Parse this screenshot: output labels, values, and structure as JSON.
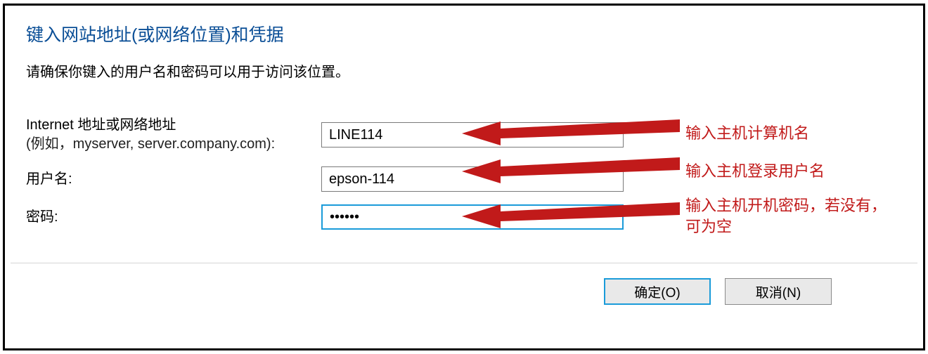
{
  "heading": "键入网站地址(或网络位置)和凭据",
  "subtitle": "请确保你键入的用户名和密码可以用于访问该位置。",
  "address_label_line1": "Internet 地址或网络地址",
  "address_label_line2": "(例如，myserver, server.company.com):",
  "address_value": "LINE114",
  "username_label": "用户名:",
  "username_value": "epson-114",
  "password_label": "密码:",
  "password_value": "••••••",
  "annot1": "输入主机计算机名",
  "annot2": "输入主机登录用户名",
  "annot3": "输入主机开机密码，若没有，可为空",
  "ok_label": "确定(O)",
  "cancel_label": "取消(N)"
}
